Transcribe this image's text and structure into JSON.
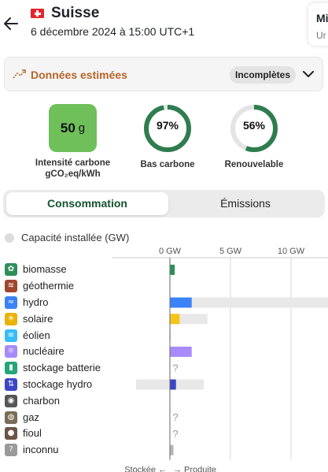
{
  "header": {
    "zone_name": "Suisse",
    "datetime": "6 décembre 2024 à 15:00 UTC+1",
    "right_card_title": "Mi",
    "right_card_sub": "Ur"
  },
  "estimated": {
    "label": "Données estimées",
    "badge": "Incomplètes"
  },
  "metrics": {
    "carbon_intensity": {
      "value": "50",
      "unit": "g",
      "label_line1": "Intensité carbone",
      "label_line2": "gCO₂eq/kWh",
      "color": "#6fbf5b"
    },
    "low_carbon": {
      "display": "97%",
      "fraction": 0.97,
      "label": "Bas carbone"
    },
    "renewable": {
      "display": "56%",
      "fraction": 0.56,
      "label": "Renouvelable"
    }
  },
  "tabs": [
    {
      "label": "Consommation",
      "active": true
    },
    {
      "label": "Émissions",
      "active": false
    }
  ],
  "capacity_toggle": {
    "label": "Capacité installée (GW)",
    "enabled": false
  },
  "chart_data": {
    "type": "bar",
    "unit": "GW",
    "x_ticks": [
      {
        "value": 0,
        "label": "0 GW"
      },
      {
        "value": 5,
        "label": "5 GW"
      },
      {
        "value": 10,
        "label": "10 GW"
      }
    ],
    "axis_legend": {
      "left": "Stockée ←",
      "right": "→ Produite"
    },
    "colors": {
      "bar_bg": "#e8e8e8",
      "axis": "#666666",
      "grid": "#d8d8d8"
    },
    "rows": [
      {
        "label": "biomasse",
        "icon": "leaf-icon",
        "icon_glyph": "✿",
        "icon_color": "#2f8f5b",
        "value": 0.4,
        "capacity": null,
        "unknown": false,
        "bar_color": "#2f8f5b"
      },
      {
        "label": "géothermie",
        "icon": "heat-icon",
        "icon_glyph": "≋",
        "icon_color": "#a0462e",
        "value": 0,
        "capacity": null,
        "unknown": false,
        "bar_color": "#a0462e"
      },
      {
        "label": "hydro",
        "icon": "waves-icon",
        "icon_glyph": "≈",
        "icon_color": "#3b82f6",
        "value": 1.8,
        "capacity": 15.5,
        "unknown": false,
        "bar_color": "#3b82f6"
      },
      {
        "label": "solaire",
        "icon": "sun-icon",
        "icon_glyph": "☀",
        "icon_color": "#eab308",
        "value": 0.8,
        "capacity": 3.1,
        "unknown": false,
        "bar_color": "#f5c518"
      },
      {
        "label": "éolien",
        "icon": "wind-icon",
        "icon_glyph": "≡",
        "icon_color": "#38bdf8",
        "value": 0,
        "capacity": 0.1,
        "unknown": false,
        "bar_color": "#38bdf8"
      },
      {
        "label": "nucléaire",
        "icon": "atom-icon",
        "icon_glyph": "⚛",
        "icon_color": "#a78bfa",
        "value": 1.8,
        "capacity": null,
        "unknown": false,
        "bar_color": "#a78bfa"
      },
      {
        "label": "stockage batterie",
        "icon": "battery-icon",
        "icon_glyph": "▮",
        "icon_color": "#22a67a",
        "value": null,
        "capacity": null,
        "unknown": true,
        "bar_color": "#22a67a"
      },
      {
        "label": "stockage hydro",
        "icon": "pumped-storage-icon",
        "icon_glyph": "⇅",
        "icon_color": "#3b46c7",
        "value": 0.5,
        "capacity": 2.8,
        "storage_capacity": -2.8,
        "unknown": false,
        "bar_color": "#3b46c7"
      },
      {
        "label": "charbon",
        "icon": "coal-icon",
        "icon_glyph": "◉",
        "icon_color": "#555555",
        "value": 0,
        "capacity": null,
        "unknown": false,
        "bar_color": "#555555"
      },
      {
        "label": "gaz",
        "icon": "gas-icon",
        "icon_glyph": "◍",
        "icon_color": "#7a6b55",
        "value": null,
        "capacity": null,
        "unknown": true,
        "bar_color": "#7a6b55"
      },
      {
        "label": "fioul",
        "icon": "oil-drop-icon",
        "icon_glyph": "●",
        "icon_color": "#6b5544",
        "value": null,
        "capacity": null,
        "unknown": true,
        "bar_color": "#6b5544"
      },
      {
        "label": "inconnu",
        "icon": "question-icon",
        "icon_glyph": "?",
        "icon_color": "#9a9a9a",
        "value": 0.3,
        "capacity": null,
        "unknown": false,
        "bar_color": "#b8b8b8"
      }
    ]
  }
}
